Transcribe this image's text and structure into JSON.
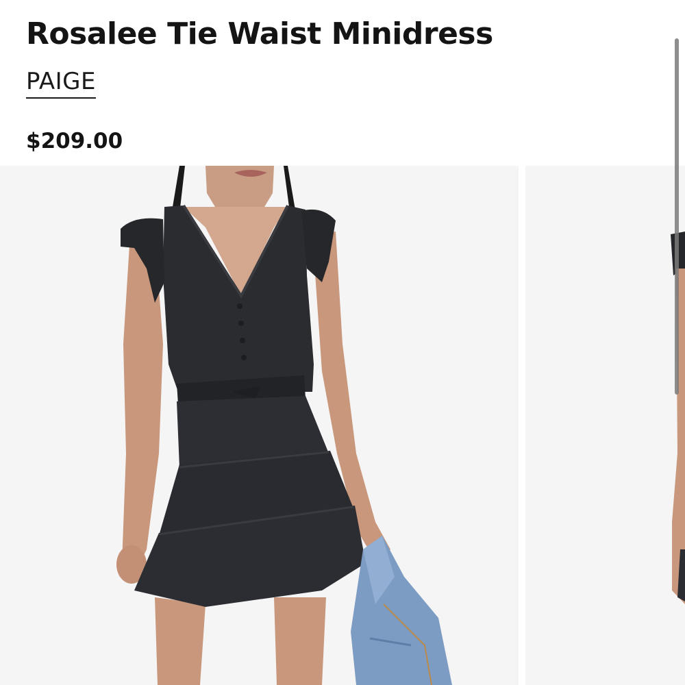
{
  "product": {
    "title": "Rosalee Tie Waist Minidress",
    "brand": "PAIGE",
    "price": "$209.00"
  },
  "gallery": {
    "images": [
      {
        "alt": "model-wearing-black-minidress-with-denim-jacket"
      },
      {
        "alt": "model-wearing-black-minidress-side"
      }
    ]
  },
  "colors": {
    "text": "#141414",
    "photo_background": "#f5f5f5",
    "dress": "#2b2c30",
    "denim": "#7d9cc3"
  }
}
